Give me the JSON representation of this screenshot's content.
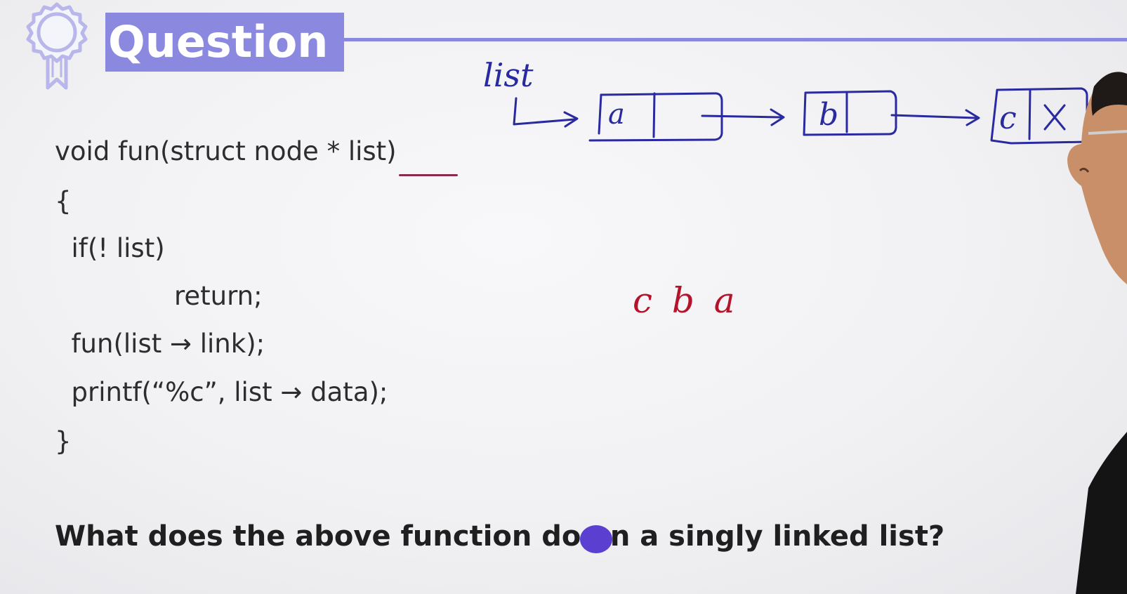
{
  "header": {
    "title": "Question"
  },
  "code": {
    "lines": [
      "void fun(struct node * list)",
      "{",
      "  if(! list)",
      "return;",
      "  fun(list → link);",
      "  printf(“%c”, list → data);",
      "}"
    ]
  },
  "annotations": {
    "list_label": "list",
    "nodes": [
      "a",
      "b",
      "c"
    ],
    "null_mark": "X",
    "output": "c b a"
  },
  "question": {
    "part1": "What does the above function do",
    "part2": " on a singly linked list?"
  },
  "colors": {
    "accent": "#8b88df",
    "ink_blue": "#2a2aa0",
    "ink_red": "#b5132b",
    "code_text": "#2d2d2d"
  }
}
